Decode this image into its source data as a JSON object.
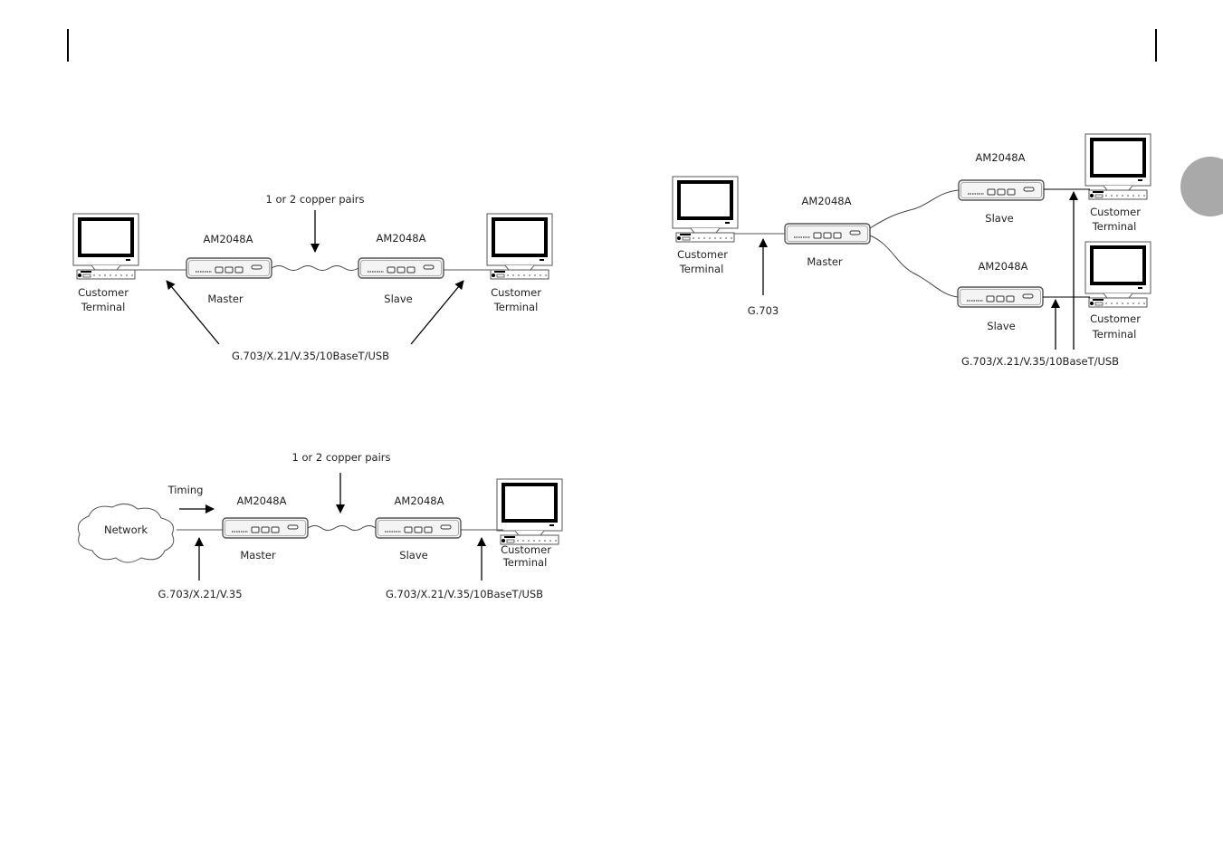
{
  "page": {
    "thumb_tab_color": "#a9a9a9"
  },
  "diagram1": {
    "left_terminal_label": [
      "Customer",
      "Terminal"
    ],
    "master_model": "AM2048A",
    "master_role": "Master",
    "slave_model": "AM2048A",
    "slave_role": "Slave",
    "right_terminal_label": [
      "Customer",
      "Terminal"
    ],
    "line_label": "1 or 2 copper pairs",
    "interface_label": "G.703/X.21/V.35/10BaseT/USB"
  },
  "diagram2": {
    "network_label": "Network",
    "timing_label": "Timing",
    "master_model": "AM2048A",
    "master_role": "Master",
    "slave_model": "AM2048A",
    "slave_role": "Slave",
    "right_terminal_label": [
      "Customer",
      "Terminal"
    ],
    "line_label": "1 or 2 copper pairs",
    "network_interface_label": "G.703/X.21/V.35",
    "terminal_interface_label": "G.703/X.21/V.35/10BaseT/USB"
  },
  "diagram3": {
    "left_terminal_label": [
      "Customer",
      "Terminal"
    ],
    "master_model": "AM2048A",
    "master_role": "Master",
    "master_interface_label": "G.703",
    "slave_top_model": "AM2048A",
    "slave_top_role": "Slave",
    "slave_bottom_model": "AM2048A",
    "slave_bottom_role": "Slave",
    "top_terminal_label": [
      "Customer",
      "Terminal"
    ],
    "bottom_terminal_label": [
      "Customer",
      "Terminal"
    ],
    "slave_interface_label": "G.703/X.21/V.35/10BaseT/USB"
  }
}
